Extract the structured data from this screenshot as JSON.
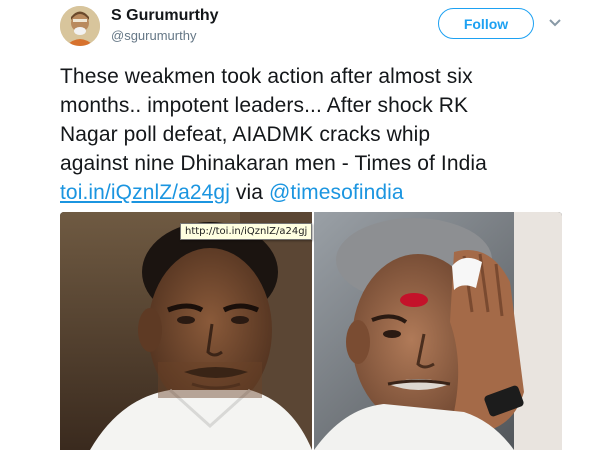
{
  "tweet": {
    "author_name": "S Gurumurthy",
    "handle": "@sgurumurthy",
    "follow_label": "Follow",
    "text_lines": [
      "These weakmen took action after almost six",
      "months.. impotent leaders... After shock RK",
      "Nagar poll defeat, AIADMK cracks whip",
      "against nine Dhinakaran men - Times of India"
    ],
    "link_text": "toi.in/iQznlZ/a24gj",
    "via_text": "via",
    "mention_text": "@timesofindia",
    "link_tooltip": "http://toi.in/iQznlZ/a24gj"
  },
  "icons": {
    "avatar": "avatar-portrait",
    "more": "chevron-down-icon"
  },
  "colors": {
    "accent": "#1da1f2",
    "link": "#1b95e0",
    "text": "#14171a",
    "secondary": "#657786"
  }
}
